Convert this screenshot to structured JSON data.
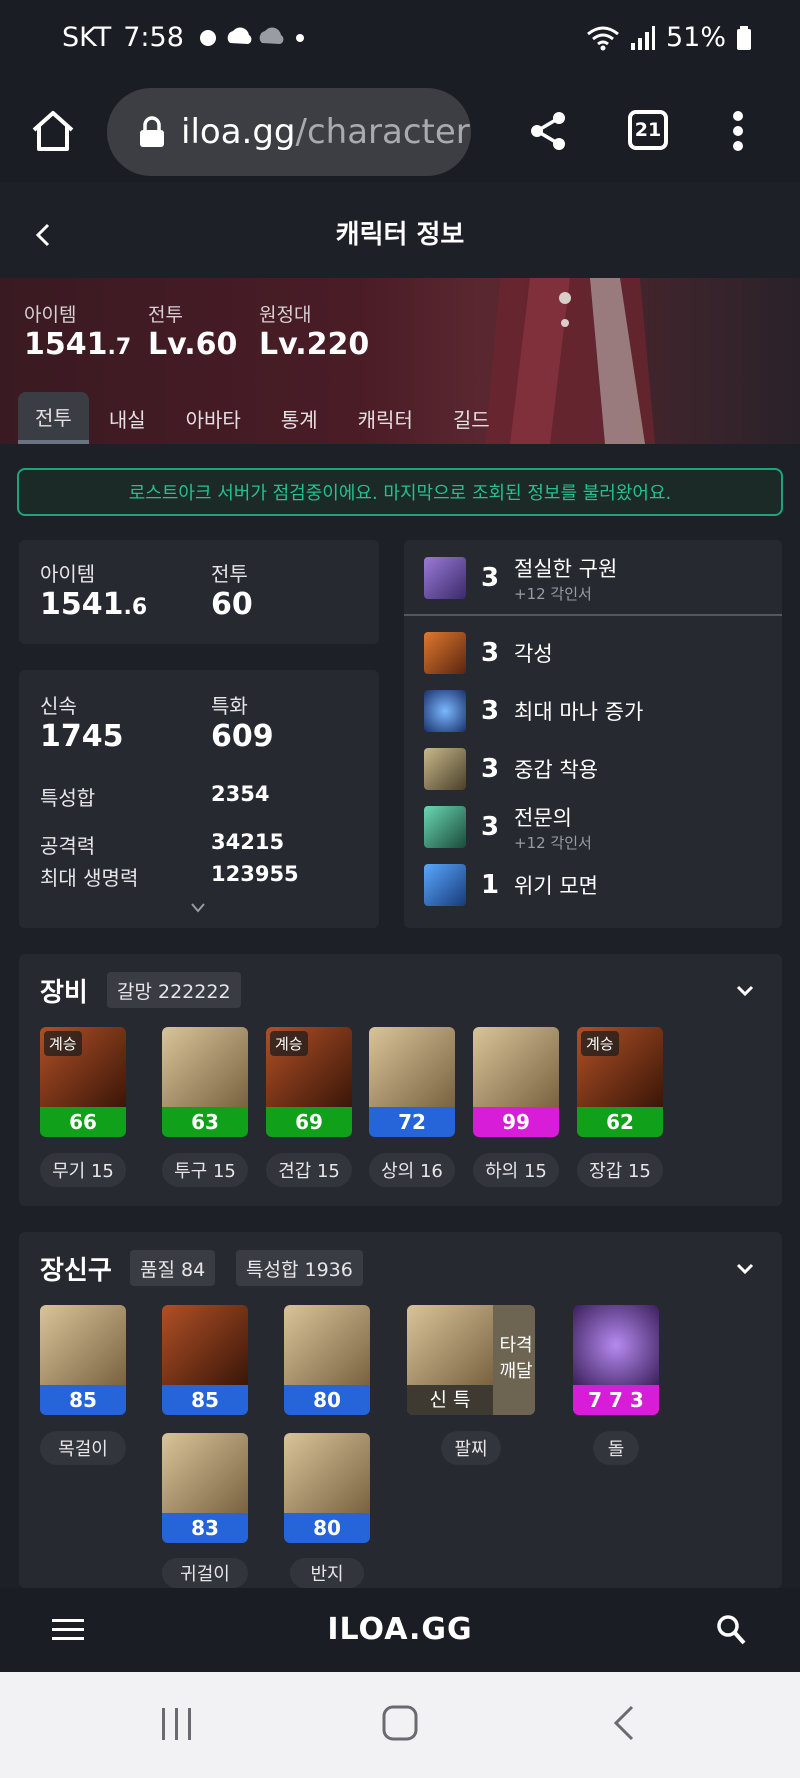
{
  "status_bar": {
    "carrier": "SKT",
    "time": "7:58",
    "battery": "51%"
  },
  "browser": {
    "url_host": "iloa.gg",
    "url_path": "/character",
    "tab_count": "21"
  },
  "header": {
    "title": "캐릭터 정보"
  },
  "hero": {
    "item_label": "아이템",
    "item_value_main": "1541",
    "item_value_decimal": ".7",
    "combat_label": "전투",
    "combat_value": "Lv.60",
    "expedition_label": "원정대",
    "expedition_value": "Lv.220"
  },
  "tabs": [
    "전투",
    "내실",
    "아바타",
    "통계",
    "캐릭터",
    "길드"
  ],
  "notice": "로스트아크 서버가 점검중이에요. 마지막으로 조회된 정보를 불러왔어요.",
  "summary": {
    "item_label": "아이템",
    "item_main": "1541",
    "item_decimal": ".6",
    "combat_label": "전투",
    "combat_value": "60"
  },
  "stats": {
    "swift_label": "신속",
    "swift_value": "1745",
    "crit_label": "특화",
    "crit_value": "609",
    "total_label": "특성합",
    "total_value": "2354",
    "attack_label": "공격력",
    "attack_value": "34215",
    "hp_label": "최대 생명력",
    "hp_value": "123955"
  },
  "engravings": [
    {
      "level": "3",
      "name": "절실한 구원",
      "sub": "+12 각인서",
      "color": "#6b4fb0"
    },
    {
      "level": "3",
      "name": "각성",
      "sub": "",
      "color": "#b5541c"
    },
    {
      "level": "3",
      "name": "최대 마나 증가",
      "sub": "",
      "color": "#2f56b8"
    },
    {
      "level": "3",
      "name": "중갑 착용",
      "sub": "",
      "color": "#8a7b58"
    },
    {
      "level": "3",
      "name": "전문의",
      "sub": "+12 각인서",
      "color": "#3a8a72"
    },
    {
      "level": "1",
      "name": "위기 모면",
      "sub": "",
      "color": "#2f73c8"
    }
  ],
  "equipment": {
    "title": "장비",
    "badge": "갈망 222222",
    "items": [
      {
        "tag": "계승",
        "value": "66",
        "label": "무기 15",
        "grade": "green",
        "art": "#8a3a18"
      },
      {
        "tag": "",
        "value": "63",
        "label": "투구 15",
        "grade": "green",
        "art": "#b89a6a"
      },
      {
        "tag": "계승",
        "value": "69",
        "label": "견갑 15",
        "grade": "green",
        "art": "#8a3a18"
      },
      {
        "tag": "",
        "value": "72",
        "label": "상의 16",
        "grade": "blue",
        "art": "#b89a6a"
      },
      {
        "tag": "",
        "value": "99",
        "label": "하의 15",
        "grade": "magenta",
        "art": "#b89a6a"
      },
      {
        "tag": "계승",
        "value": "62",
        "label": "장갑 15",
        "grade": "green",
        "art": "#8a3a18"
      }
    ]
  },
  "accessories": {
    "title": "장신구",
    "badge_quality": "품질 84",
    "badge_stats": "특성합 1936",
    "items": [
      {
        "value": "85",
        "label": "목걸이",
        "grade": "blue",
        "art": "#b89a6a"
      },
      {
        "value": "85",
        "label": "",
        "grade": "blue",
        "art": "#8a3a18"
      },
      {
        "value": "80",
        "label": "",
        "grade": "blue",
        "art": "#b89a6a"
      },
      {
        "value": "83",
        "label": "귀걸이",
        "grade": "blue",
        "art": "#b89a6a"
      },
      {
        "value": "80",
        "label": "반지",
        "grade": "blue",
        "art": "#b89a6a"
      }
    ],
    "bracelet": {
      "bottom": "신 특",
      "side_line1": "타격",
      "side_line2": "깨달",
      "label": "팔찌"
    },
    "stone": {
      "value": "7 7 3",
      "label": "돌"
    }
  },
  "footer": {
    "logo": "ILOA.GG"
  }
}
